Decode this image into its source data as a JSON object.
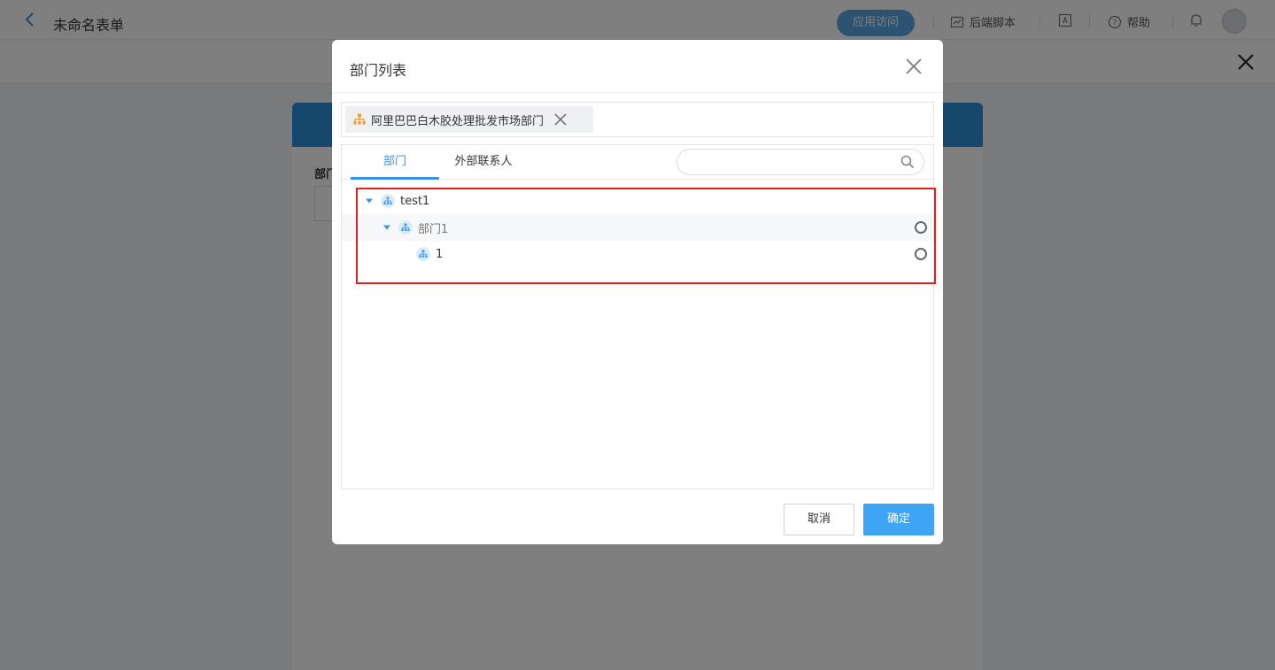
{
  "app": {
    "title": "未命名表单",
    "visit_button": "应用访问",
    "tools": {
      "script": "后端脚本",
      "help": "帮助"
    }
  },
  "form": {
    "field_label": "部门"
  },
  "dialog": {
    "title": "部门列表",
    "selected_chip": "阿里巴巴白木胶处理批发市场部门",
    "tabs": [
      {
        "label": "部门",
        "active": true
      },
      {
        "label": "外部联系人",
        "active": false
      }
    ],
    "search_placeholder": "",
    "tree": [
      {
        "label": "test1",
        "level": 0,
        "expanded": true,
        "selectable": false
      },
      {
        "label": "部门1",
        "level": 1,
        "expanded": true,
        "selectable": true
      },
      {
        "label": "1",
        "level": 2,
        "expanded": false,
        "selectable": true
      }
    ],
    "cancel_label": "取消",
    "confirm_label": "确定"
  },
  "colors": {
    "accent": "#3a92e3",
    "confirm": "#3ea5f5",
    "chip_icon": "#f39a2b",
    "highlight_box": "#e0201e"
  },
  "icons": [
    "back-arrow-icon",
    "script-icon",
    "help-icon",
    "bell-icon",
    "close-icon",
    "org-icon",
    "search-icon",
    "caret-down-icon",
    "radio-icon"
  ]
}
